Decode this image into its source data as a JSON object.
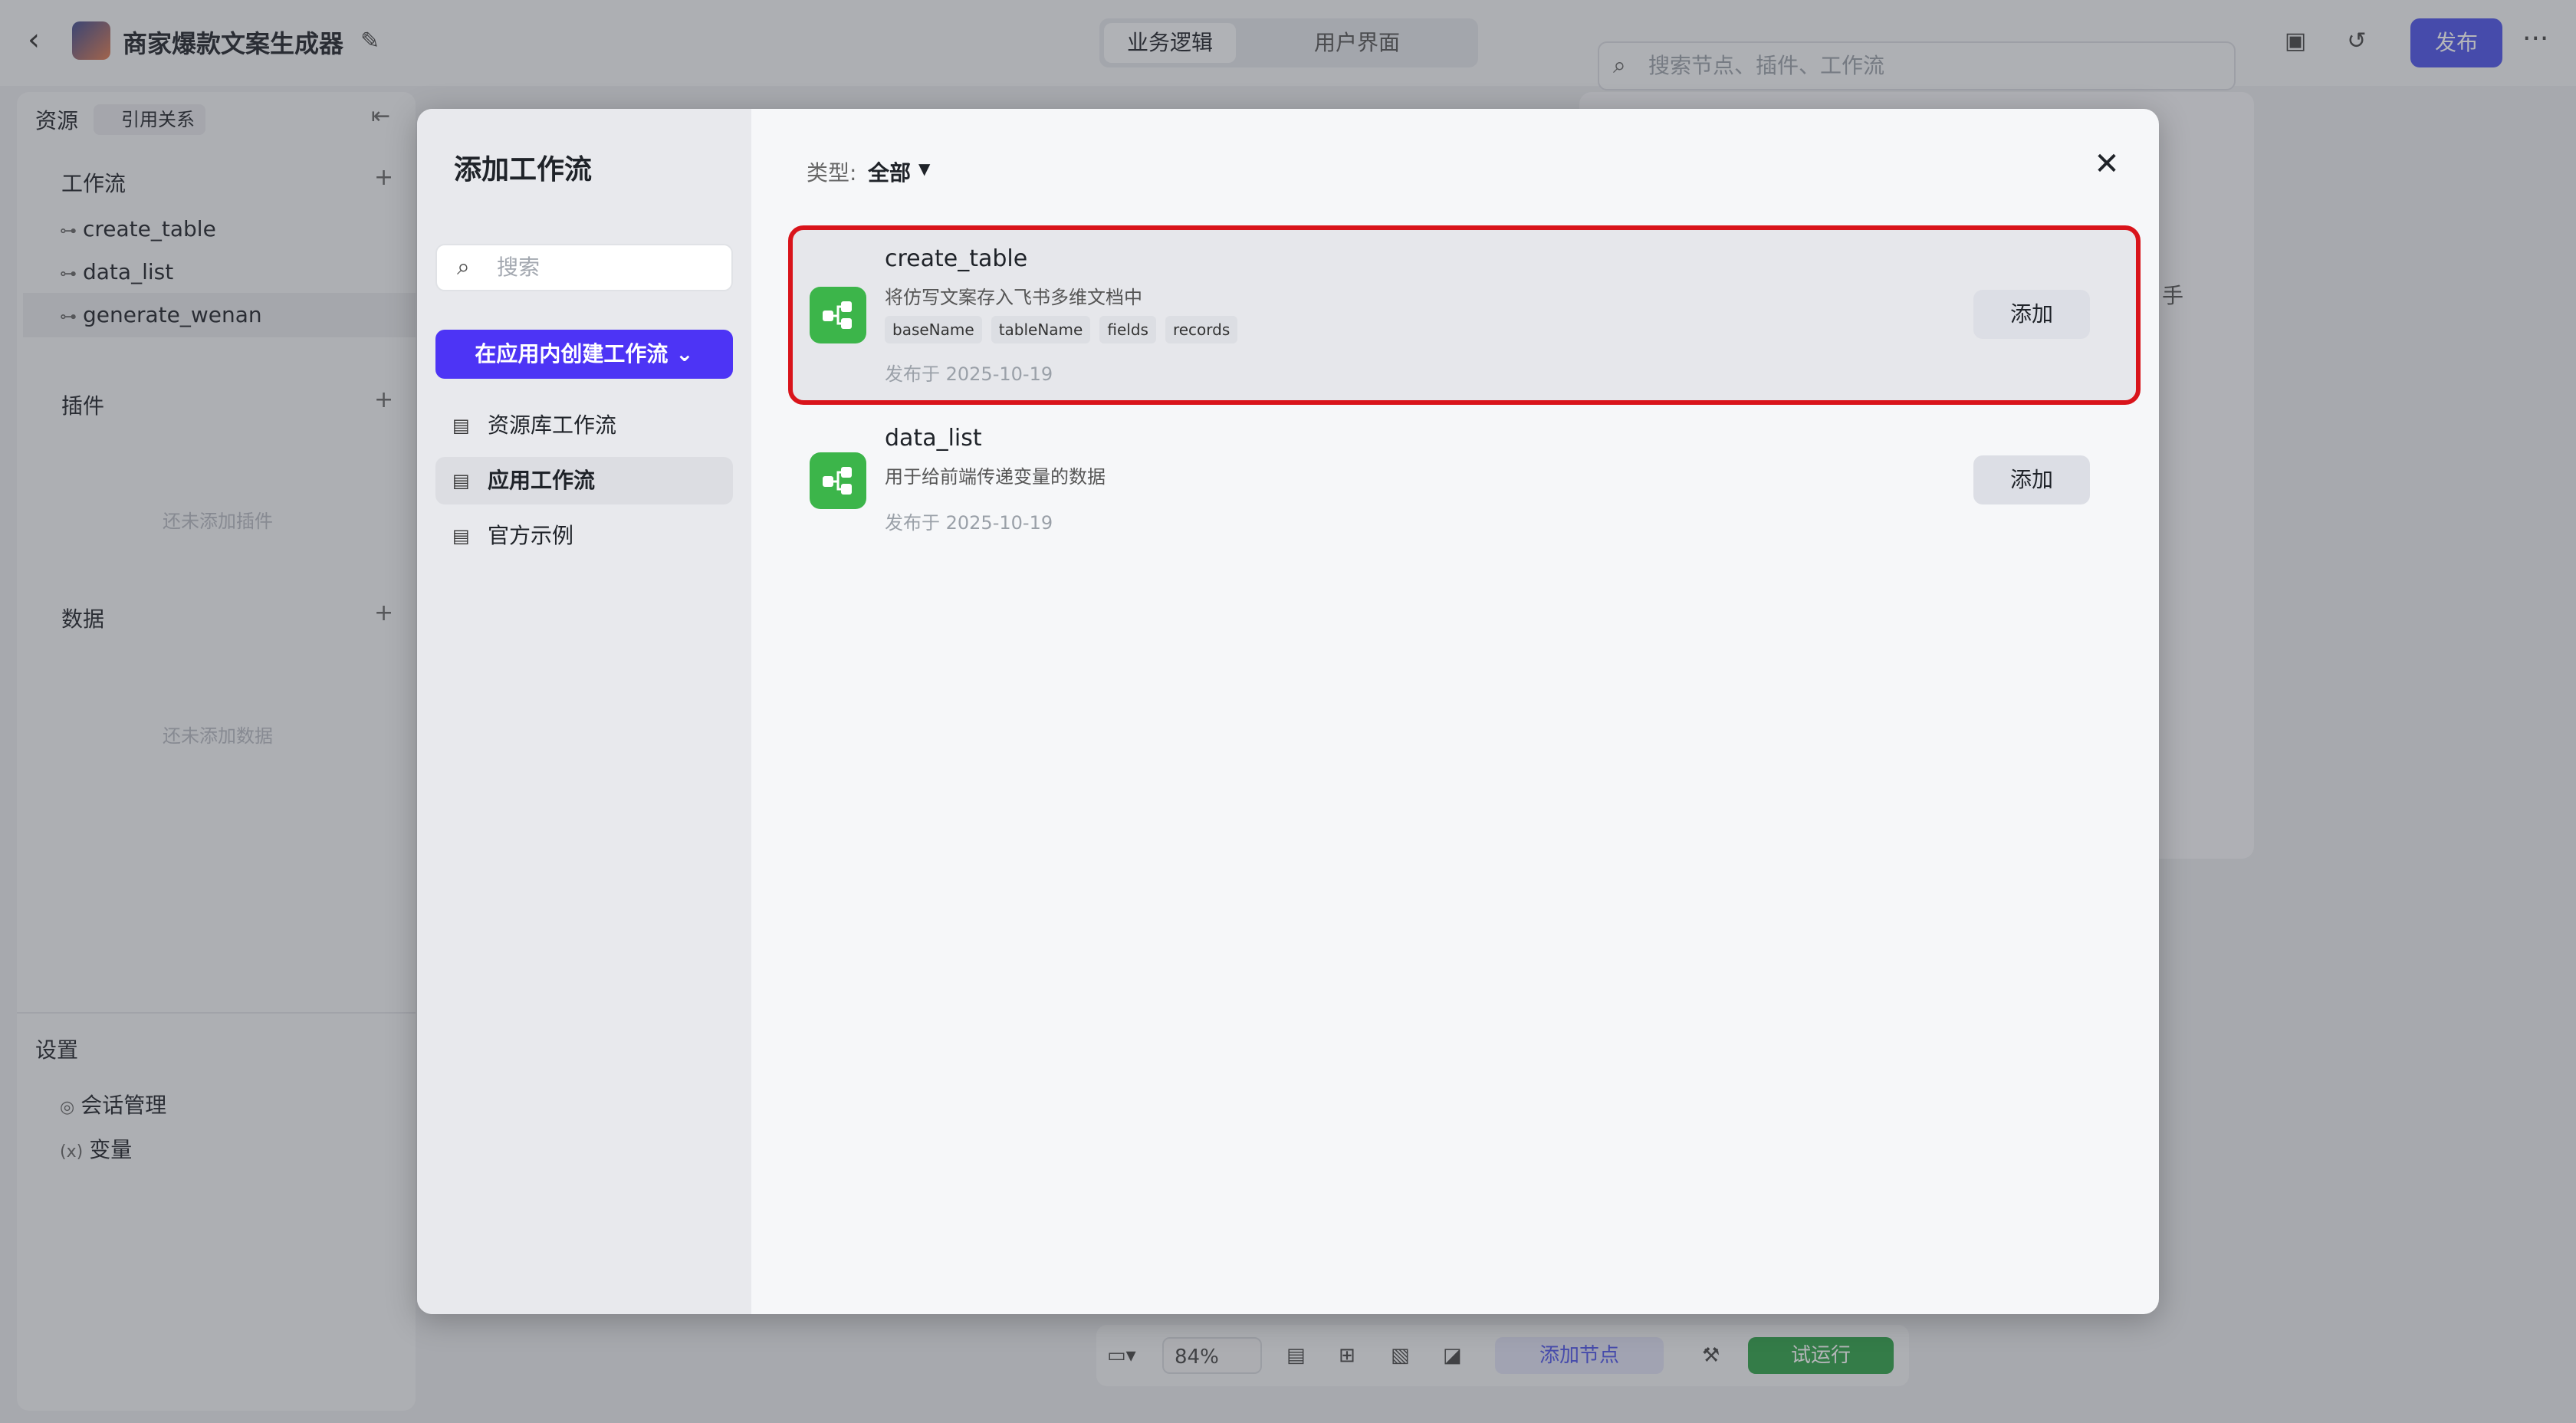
{
  "app": {
    "title": "商家爆款文案生成器"
  },
  "top_tabs": [
    {
      "label": "业务逻辑"
    },
    {
      "label": "用户界面"
    }
  ],
  "top_search": {
    "placeholder": "搜索节点、插件、工作流"
  },
  "publish_label": "发布",
  "sidebar": {
    "resources_label": "资源",
    "references_label": "引用关系",
    "workflows": {
      "label": "工作流",
      "items": [
        {
          "label": "create_table"
        },
        {
          "label": "data_list"
        },
        {
          "label": "generate_wenan"
        }
      ]
    },
    "plugins": {
      "label": "插件",
      "empty_text": "还未添加插件"
    },
    "data": {
      "label": "数据",
      "empty_text": "还未添加数据"
    },
    "settings": {
      "label": "设置",
      "items": [
        {
          "label": "会话管理"
        },
        {
          "label": "变量"
        }
      ]
    }
  },
  "canvas_panel": {
    "fragment_text": "手"
  },
  "bottom_bar": {
    "zoom": "84%",
    "add_node_label": "添加节点",
    "run_label": "试运行"
  },
  "modal": {
    "title": "添加工作流",
    "search_placeholder": "搜索",
    "create_button_label": "在应用内创建工作流",
    "nav": [
      {
        "label": "资源库工作流"
      },
      {
        "label": "应用工作流"
      },
      {
        "label": "官方示例"
      }
    ],
    "type_label": "类型:",
    "type_value": "全部",
    "cards": [
      {
        "name": "create_table",
        "description": "将仿写文案存入飞书多维文档中",
        "tags": [
          "baseName",
          "tableName",
          "fields",
          "records"
        ],
        "date": "发布于 2025-10-19",
        "add_label": "添加"
      },
      {
        "name": "data_list",
        "description": "用于给前端传递变量的数据",
        "tags": [],
        "date": "发布于 2025-10-19",
        "add_label": "添加"
      }
    ]
  },
  "colors": {
    "accent": "#4d34f5",
    "publish": "#4d53e8",
    "highlight": "#d9141b",
    "workflow_icon": "#3cb54a",
    "run": "#2fa24a"
  },
  "icons": {
    "back": "chevron-left-icon",
    "edit": "edit-icon",
    "search": "search-icon",
    "close": "close-icon",
    "workflow": "workflow-icon"
  }
}
